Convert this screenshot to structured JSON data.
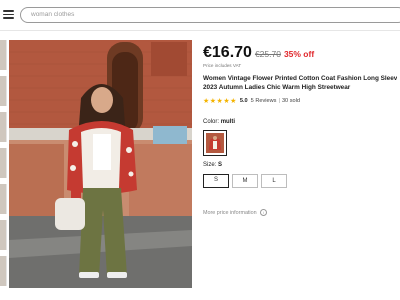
{
  "header": {
    "menu_icon": "hamburger-menu-icon",
    "search_placeholder": "woman clothes"
  },
  "product": {
    "price": "€16.70",
    "old_price": "€25.70",
    "discount": "35% off",
    "vat_note": "Price includes VAT",
    "title_line1": "Women Vintage Flower Printed Cotton Coat Fashion Long Sleeve Single",
    "title_line2": "2023 Autumn Ladies Chic Warm High Streetwear",
    "rating": {
      "stars": "★★★★★",
      "stars_value": 5,
      "score": "5.0",
      "reviews": "5 Reviews",
      "separator": "|",
      "sold": "30 sold"
    },
    "color": {
      "label": "Color:",
      "value": "multi"
    },
    "size": {
      "label": "Size:",
      "value": "S",
      "options": [
        "S",
        "M",
        "L"
      ]
    },
    "more_info": "More price information",
    "info_icon": "info-circle-icon"
  },
  "colors": {
    "discount_red": "#e0262b",
    "star_yellow": "#f4b400"
  }
}
